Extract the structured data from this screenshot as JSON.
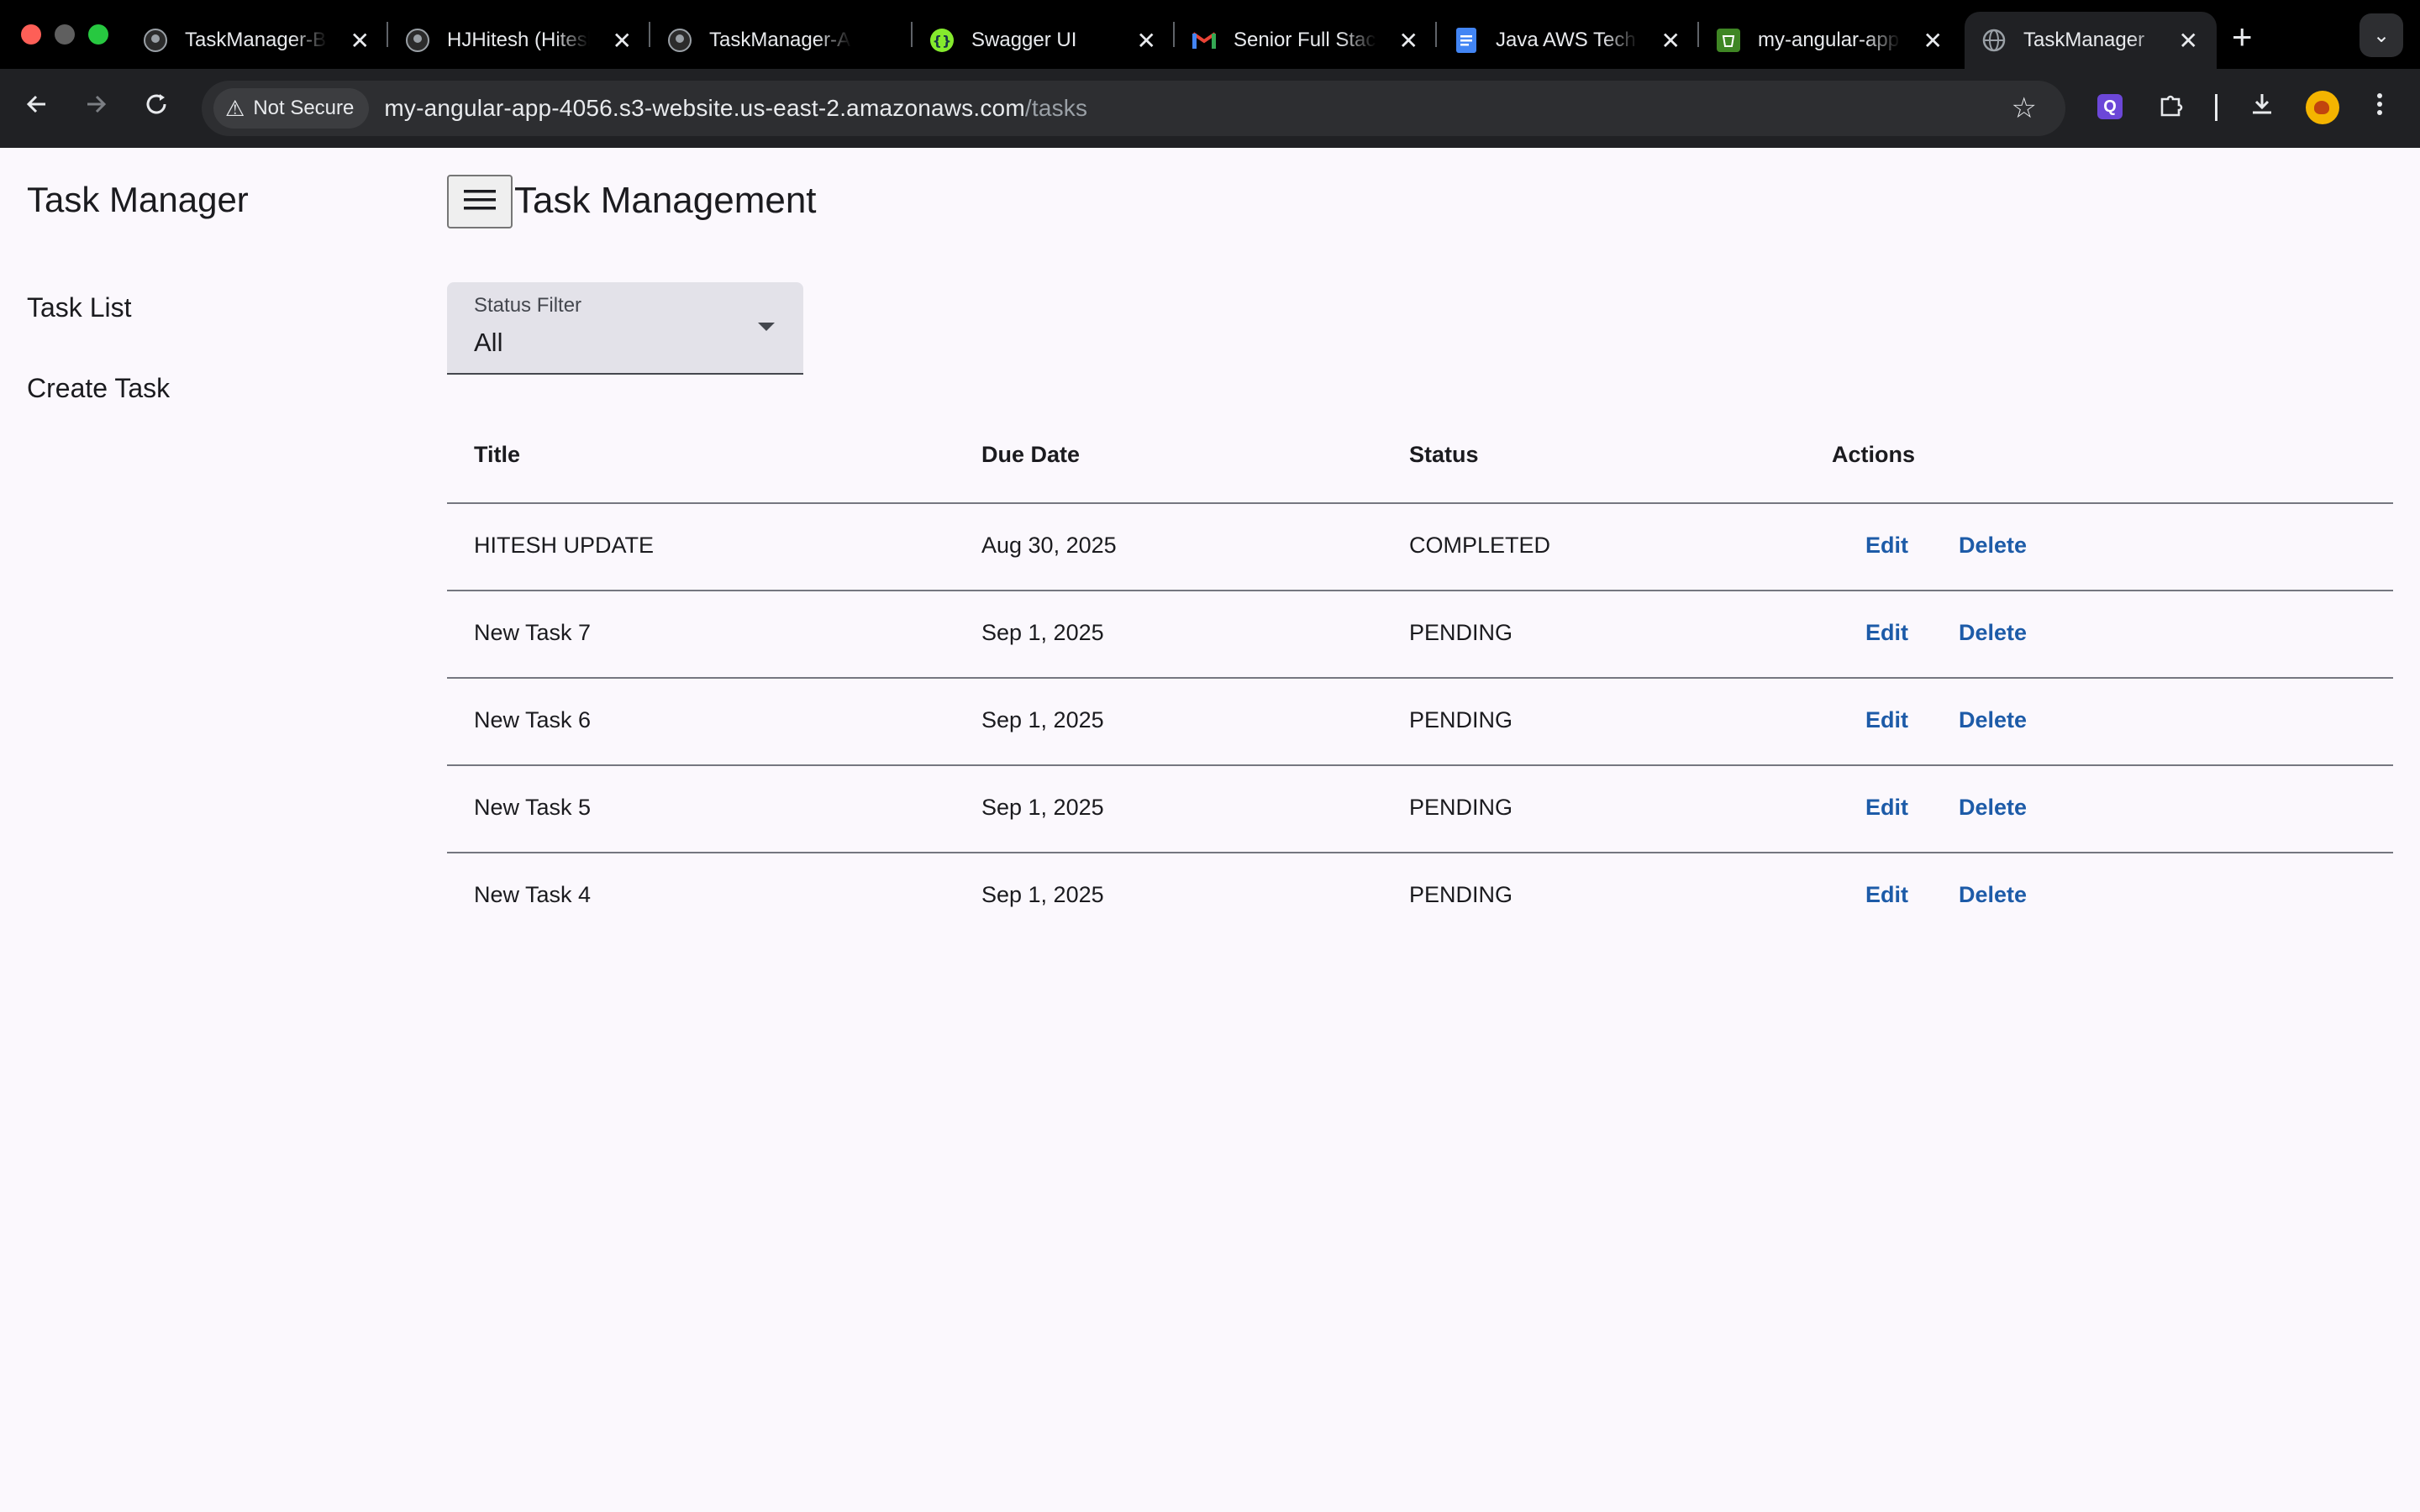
{
  "browser": {
    "tabs": [
      {
        "title": "TaskManager-B",
        "icon": "github-icon"
      },
      {
        "title": "HJHitesh (Hitesh",
        "icon": "github-icon"
      },
      {
        "title": "TaskManager-A",
        "icon": "github-icon"
      },
      {
        "title": "Swagger UI",
        "icon": "swagger-icon"
      },
      {
        "title": "Senior Full Stack",
        "icon": "gmail-icon"
      },
      {
        "title": "Java AWS Tech",
        "icon": "docs-icon"
      },
      {
        "title": "my-angular-app",
        "icon": "s3-icon"
      },
      {
        "title": "TaskManager",
        "icon": "globe-icon",
        "active": true
      }
    ],
    "security_label": "Not Secure",
    "url_host": "my-angular-app-4056.s3-website.us-east-2.amazonaws.com",
    "url_path": "/tasks",
    "extension_letter": "Q"
  },
  "sidebar": {
    "title": "Task Manager",
    "items": [
      {
        "label": "Task List"
      },
      {
        "label": "Create Task"
      }
    ]
  },
  "header": {
    "title": "Task Management"
  },
  "filter": {
    "label": "Status Filter",
    "value": "All"
  },
  "table": {
    "columns": [
      "Title",
      "Due Date",
      "Status",
      "Actions"
    ],
    "rows": [
      {
        "title": "HITESH UPDATE",
        "due": "Aug 30, 2025",
        "status": "COMPLETED",
        "edit": "Edit",
        "delete": "Delete"
      },
      {
        "title": "New Task 7",
        "due": "Sep 1, 2025",
        "status": "PENDING",
        "edit": "Edit",
        "delete": "Delete"
      },
      {
        "title": "New Task 6",
        "due": "Sep 1, 2025",
        "status": "PENDING",
        "edit": "Edit",
        "delete": "Delete"
      },
      {
        "title": "New Task 5",
        "due": "Sep 1, 2025",
        "status": "PENDING",
        "edit": "Edit",
        "delete": "Delete"
      },
      {
        "title": "New Task 4",
        "due": "Sep 1, 2025",
        "status": "PENDING",
        "edit": "Edit",
        "delete": "Delete"
      }
    ]
  },
  "colors": {
    "accent_link": "#1d5ba8",
    "page_background": "#fbf8fd",
    "chrome_background": "#202124"
  }
}
